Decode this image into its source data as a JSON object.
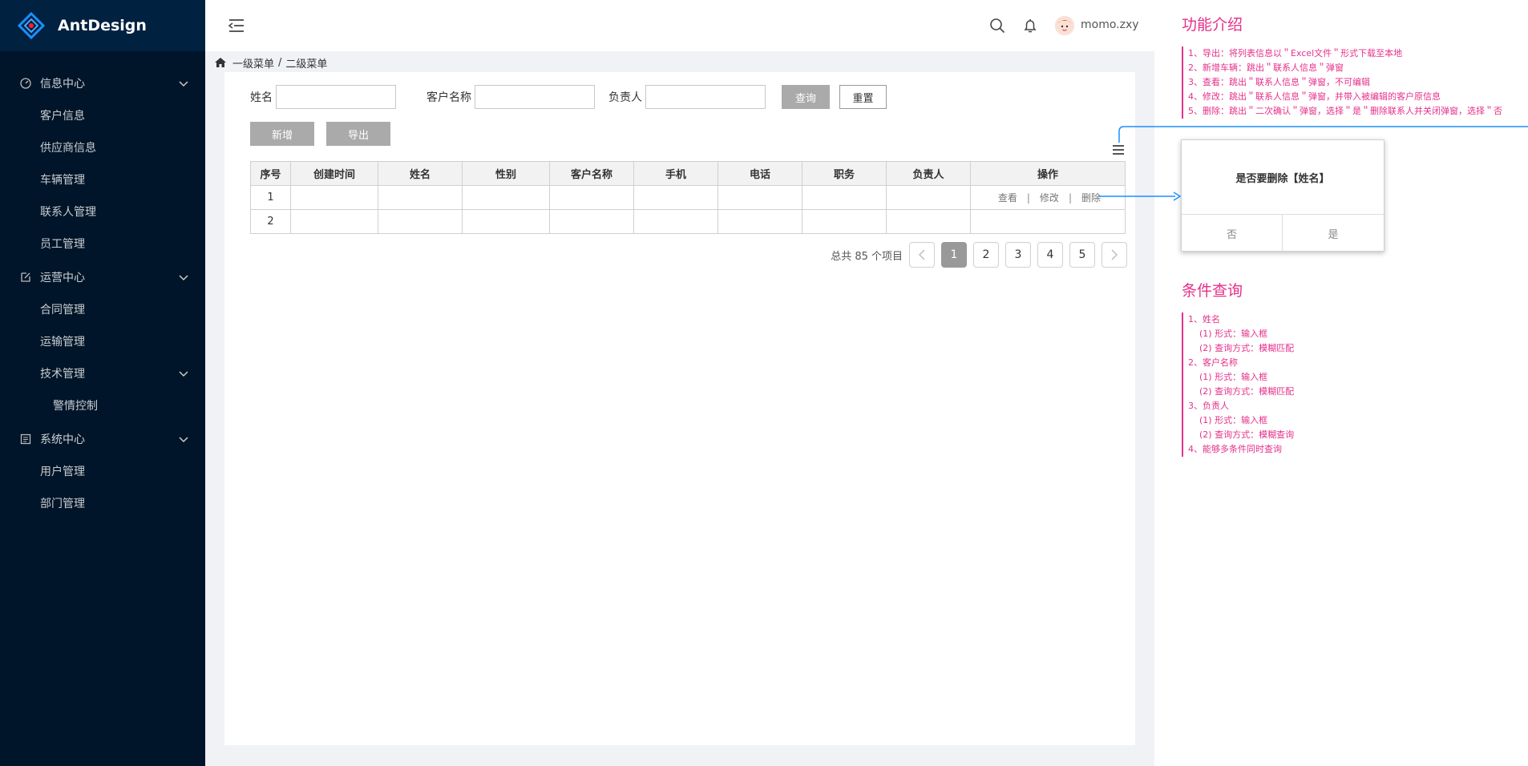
{
  "app": {
    "logo_text": "AntDesign"
  },
  "sidebar": {
    "groups": [
      {
        "label": "信息中心",
        "items": [
          "客户信息",
          "供应商信息",
          "车辆管理",
          "联系人管理",
          "员工管理"
        ]
      },
      {
        "label": "运营中心",
        "items": [
          "合同管理",
          "运输管理"
        ],
        "sub_group": {
          "label": "技术管理",
          "items": [
            "警情控制"
          ]
        }
      },
      {
        "label": "系统中心",
        "items": [
          "用户管理",
          "部门管理"
        ]
      }
    ]
  },
  "header": {
    "username": "momo.zxy"
  },
  "breadcrumb": {
    "level1": "一级菜单",
    "separator": "/",
    "level2": "二级菜单"
  },
  "filters": {
    "name_label": "姓名",
    "customer_label": "客户名称",
    "owner_label": "负责人",
    "query_button": "查询",
    "reset_button": "重置"
  },
  "actions": {
    "add_button": "新增",
    "export_button": "导出"
  },
  "table": {
    "columns": [
      "序号",
      "创建时间",
      "姓名",
      "性别",
      "客户名称",
      "手机",
      "电话",
      "职务",
      "负责人",
      "操作"
    ],
    "rows": [
      {
        "index": "1",
        "ops": {
          "view": "查看",
          "edit": "修改",
          "delete": "删除",
          "sep": "|"
        }
      },
      {
        "index": "2"
      }
    ]
  },
  "pagination": {
    "total_text": "总共 85 个项目",
    "pages": [
      "1",
      "2",
      "3",
      "4",
      "5"
    ],
    "current": "1"
  },
  "dialog": {
    "message": "是否要删除【姓名】",
    "no": "否",
    "yes": "是"
  },
  "annotations": {
    "features_title": "功能介绍",
    "features": [
      "1、导出：将列表信息以＂Excel文件＂形式下载至本地",
      "2、新增车辆：跳出＂联系人信息＂弹窗",
      "3、查看：跳出＂联系人信息＂弹窗，不可编辑",
      "4、修改：跳出＂联系人信息＂弹窗，并带入被编辑的客户原信息",
      "5、删除：跳出＂二次确认＂弹窗，选择＂是＂删除联系人并关闭弹窗，选择＂否"
    ],
    "query_title": "条件查询",
    "query": [
      {
        "text": "1、姓名",
        "indent": false
      },
      {
        "text": "(1) 形式：输入框",
        "indent": true
      },
      {
        "text": "(2) 查询方式：模糊匹配",
        "indent": true
      },
      {
        "text": "2、客户名称",
        "indent": false
      },
      {
        "text": "(1) 形式：输入框",
        "indent": true
      },
      {
        "text": "(2) 查询方式：模糊匹配",
        "indent": true
      },
      {
        "text": "3、负责人",
        "indent": false
      },
      {
        "text": "(1) 形式：输入框",
        "indent": true
      },
      {
        "text": "(2) 查询方式：模糊查询",
        "indent": true
      },
      {
        "text": "4、能够多条件同时查询",
        "indent": false
      }
    ]
  },
  "colors": {
    "sidebar_bg": "#001529",
    "accent": "#1890ff",
    "annotation": "#e5308a",
    "button_gray": "#aaaaaa"
  }
}
